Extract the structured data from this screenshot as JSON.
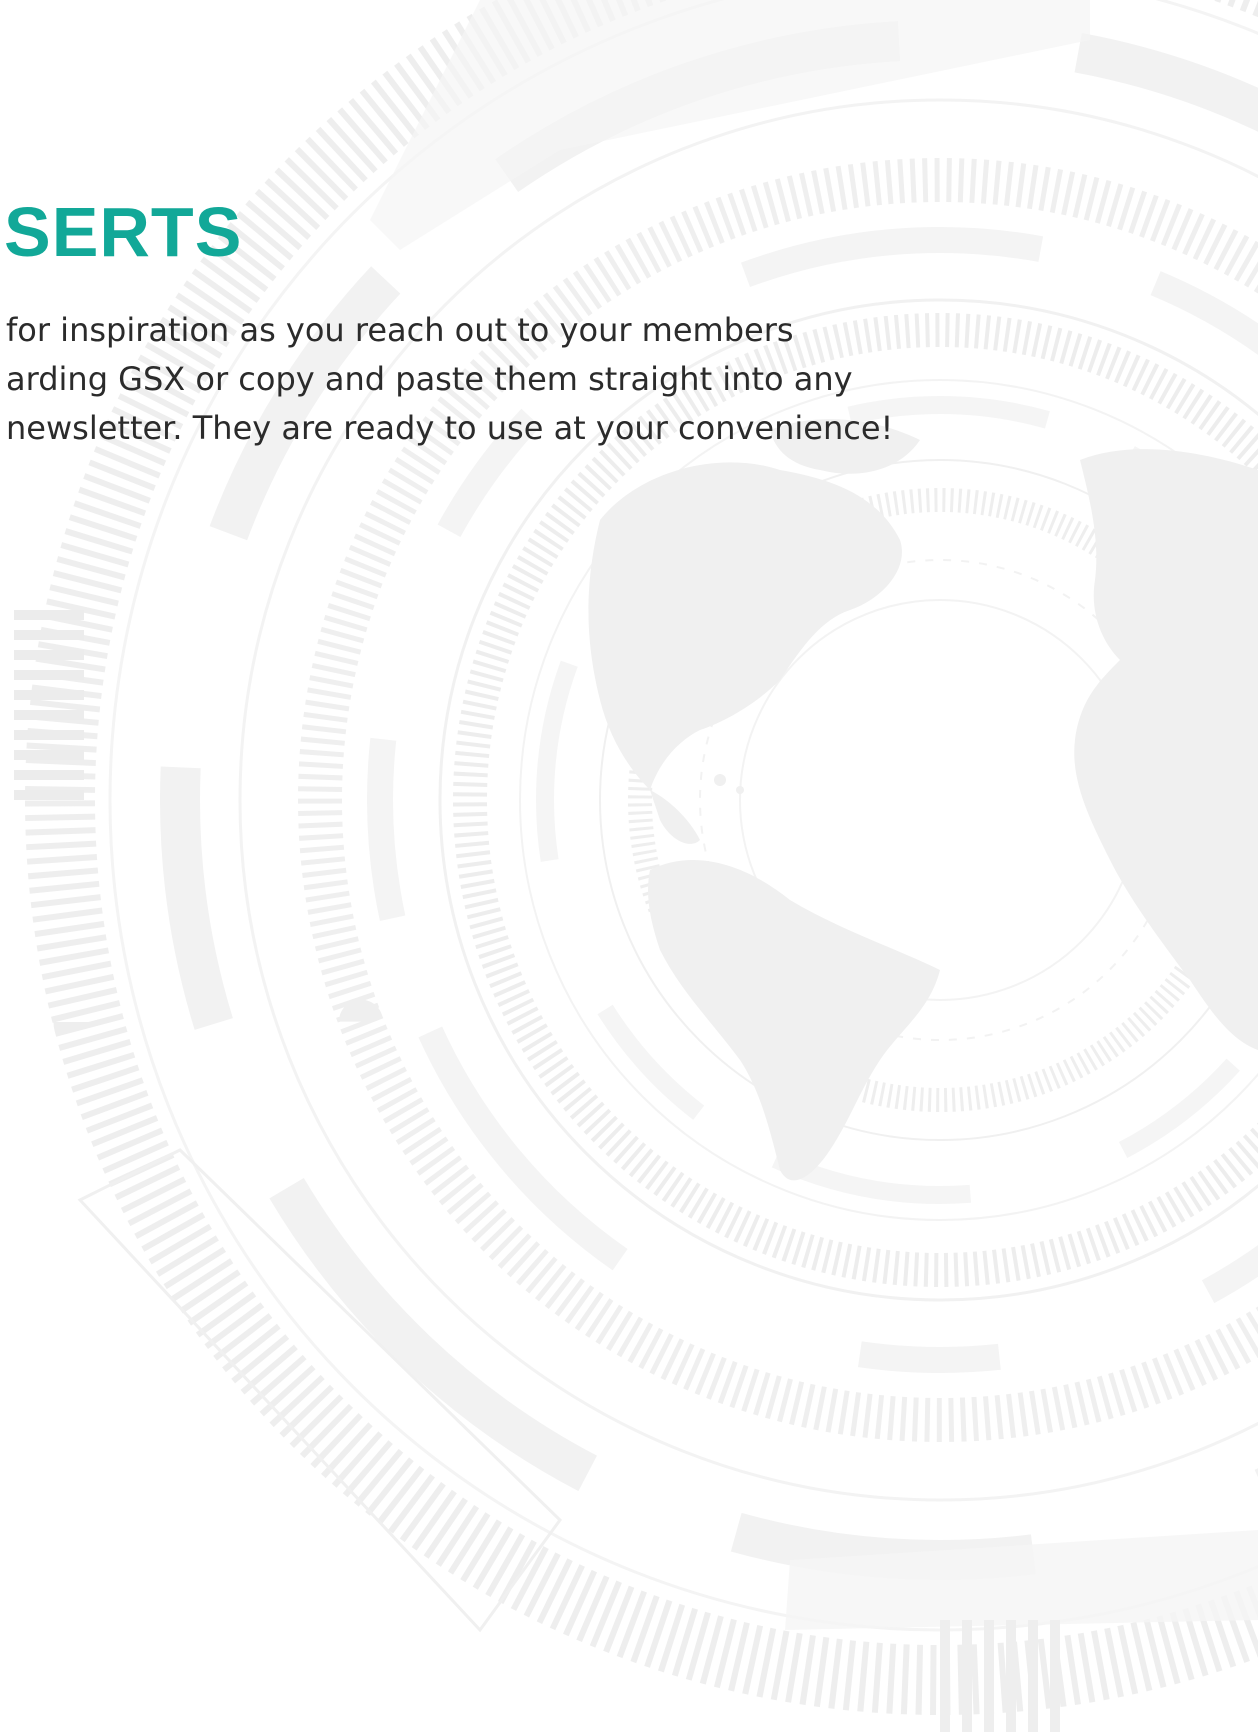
{
  "heading": {
    "text": "SERTS",
    "color": "#12a898"
  },
  "body": {
    "lines": [
      " for inspiration as you reach out to your members",
      "arding GSX or copy and paste them straight into any",
      " newsletter. They are ready to use at your convenience!"
    ]
  },
  "background": {
    "graphic": "globe-tech-rings-graphic",
    "tint": "#efefef"
  }
}
